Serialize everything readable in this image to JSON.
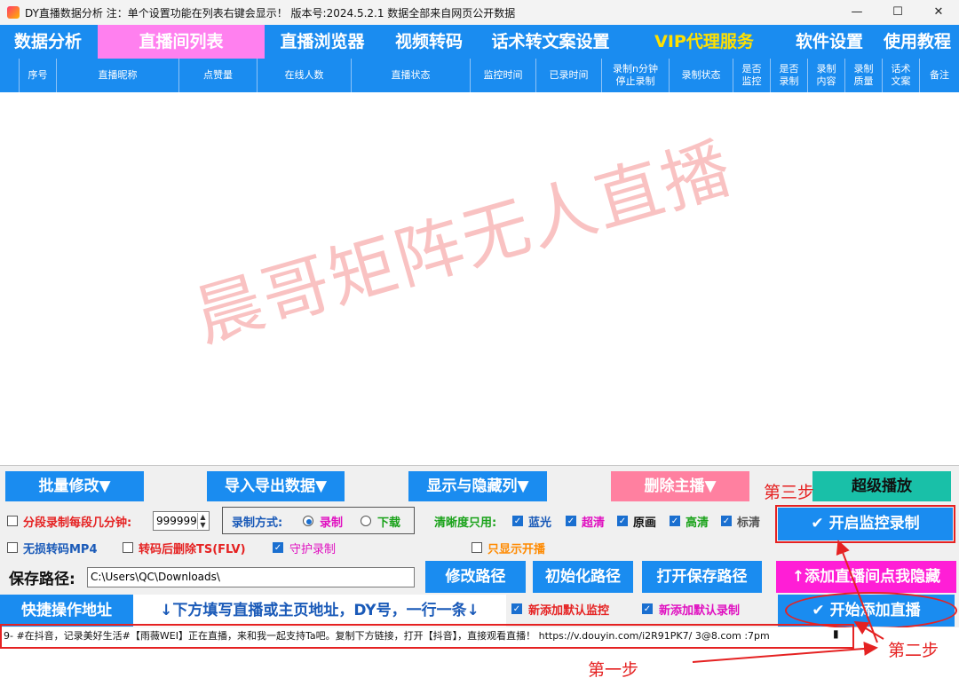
{
  "window": {
    "title": "DY直播数据分析   注：单个设置功能在列表右键会显示！   版本号:2024.5.2.1   数据全部来自网页公开数据",
    "minimize": "—",
    "maximize": "☐",
    "close": "✕"
  },
  "menu": {
    "items": [
      "数据分析",
      "直播间列表",
      "直播浏览器",
      "视频转码",
      "话术转文案设置",
      "VIP代理服务",
      "软件设置",
      "使用教程"
    ]
  },
  "table": {
    "headers": [
      "序号",
      "直播昵称",
      "点赞量",
      "在线人数",
      "直播状态",
      "监控时间",
      "已录时间",
      "录制n分钟\n停止录制",
      "录制状态",
      "是否\n监控",
      "是否\n录制",
      "录制\n内容",
      "录制\n质量",
      "话术\n文案",
      "备注"
    ]
  },
  "watermark": "晨哥矩阵无人直播",
  "toolbar": {
    "batch_edit": "批量修改▼",
    "import_export": "导入导出数据▼",
    "show_hide_cols": "显示与隐藏列▼",
    "delete_streamer": "删除主播▼",
    "super_play": "超级播放"
  },
  "options": {
    "segment_label": "分段录制每段几分钟:",
    "segment_value": "999999",
    "record_mode_label": "录制方式:",
    "record_mode_record": "录制",
    "record_mode_download": "下载",
    "clarity_label": "清晰度只用:",
    "clarity": [
      "蓝光",
      "超清",
      "原画",
      "高清",
      "标清"
    ],
    "lossless_mp4": "无损转码MP4",
    "delete_ts": "转码后删除TS(FLV)",
    "guard_record": "守护录制",
    "only_live": "只显示开播",
    "start_monitor": "开启监控录制"
  },
  "path": {
    "label": "保存路径:",
    "value": "C:\\Users\\QC\\Downloads\\",
    "modify": "修改路径",
    "init": "初始化路径",
    "open": "打开保存路径",
    "add_room_hide": "↑添加直播间点我隐藏"
  },
  "quick": {
    "label": "快捷操作地址",
    "hint": "↓下方填写直播或主页地址，DY号，一行一条↓",
    "default_monitor": "新添加默认监控",
    "default_record": "新添加默认录制",
    "start_add": "开始添加直播"
  },
  "input_line": {
    "value": "9- #在抖音，记录美好生活#【雨薇WEI】正在直播，来和我一起支持Ta吧。复制下方链接，打开【抖音】，直接观看直播！  https://v.douyin.com/i2R91PK7/ 3@8.com :7pm"
  },
  "annotations": {
    "step1": "第一步",
    "step2": "第二步",
    "step3": "第三步"
  },
  "colors": {
    "accent_blue": "#1a8cf0",
    "active_tab_pink": "#ff80ef",
    "vip_yellow": "#ffe000",
    "annotation_red": "#e52222"
  }
}
